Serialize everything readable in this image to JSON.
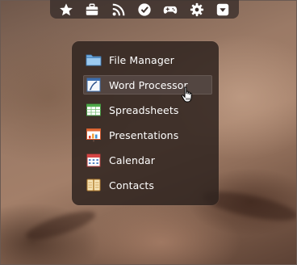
{
  "dock": {
    "items": [
      {
        "icon": "star-icon",
        "label": "Favorites"
      },
      {
        "icon": "briefcase-icon",
        "label": "Office"
      },
      {
        "icon": "rss-icon",
        "label": "News"
      },
      {
        "icon": "checkmark-circle-icon",
        "label": "Tasks"
      },
      {
        "icon": "gamepad-icon",
        "label": "Games"
      },
      {
        "icon": "gear-icon",
        "label": "Settings"
      },
      {
        "icon": "dropdown-box-icon",
        "label": "More"
      }
    ]
  },
  "menu": {
    "items": [
      {
        "label": "File Manager",
        "icon": "folder-icon"
      },
      {
        "label": "Word Processor",
        "icon": "document-pen-icon",
        "hovered": true
      },
      {
        "label": "Spreadsheets",
        "icon": "spreadsheet-icon"
      },
      {
        "label": "Presentations",
        "icon": "presentation-chart-icon"
      },
      {
        "label": "Calendar",
        "icon": "calendar-icon"
      },
      {
        "label": "Contacts",
        "icon": "address-book-icon"
      }
    ]
  },
  "colors": {
    "panel": "#30241f",
    "hover": "#554844",
    "text": "#ffffff",
    "icon_white": "#ffffff"
  }
}
